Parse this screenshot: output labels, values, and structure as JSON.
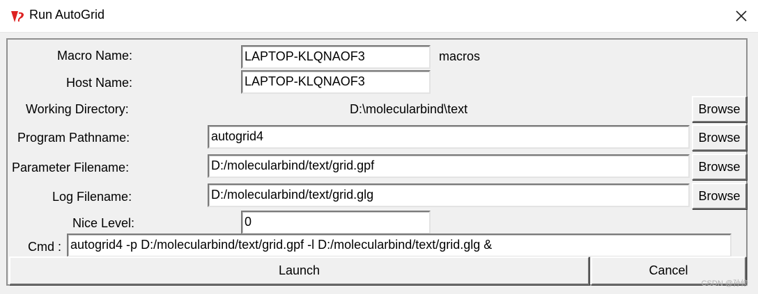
{
  "window": {
    "title": "Run AutoGrid",
    "icon": "tk-feather-icon"
  },
  "form": {
    "macro_name_label": "Macro Name:",
    "macro_name_value": "LAPTOP-KLQNAOF3",
    "macro_suffix": "macros",
    "host_name_label": "Host Name:",
    "host_name_value": "LAPTOP-KLQNAOF3",
    "working_dir_label": "Working Directory:",
    "working_dir_value": "D:\\molecularbind\\text",
    "program_label": "Program Pathname:",
    "program_value": "autogrid4",
    "param_label": "Parameter Filename:",
    "param_value": "D:/molecularbind/text/grid.gpf",
    "log_label": "Log Filename:",
    "log_value": "D:/molecularbind/text/grid.glg",
    "nice_label": "Nice Level:",
    "nice_value": "0",
    "cmd_label": "Cmd :",
    "cmd_value": "autogrid4 -p D:/molecularbind/text/grid.gpf -l D:/molecularbind/text/grid.glg &"
  },
  "buttons": {
    "browse": "Browse",
    "launch": "Launch",
    "cancel": "Cancel"
  },
  "watermark": "CSDN @孙修"
}
